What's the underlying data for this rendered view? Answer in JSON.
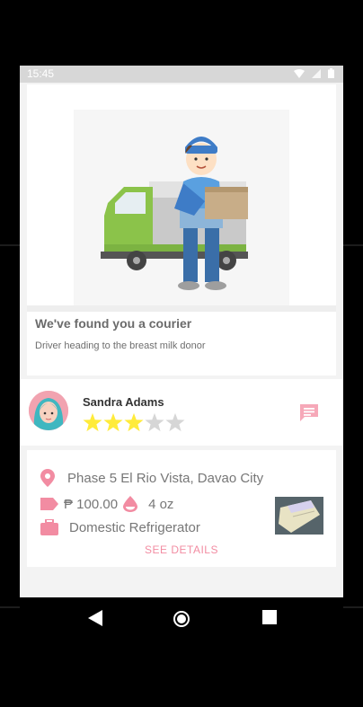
{
  "status_bar": {
    "time": "15:45"
  },
  "hero": {
    "title": "We've found you a courier",
    "subtitle": "Driver heading to the breast milk donor"
  },
  "courier": {
    "name": "Sandra Adams",
    "rating": 3,
    "rating_max": 5
  },
  "details": {
    "address": "Phase 5 El Rio Vista, Davao City",
    "price": "₱ 100.00",
    "quantity": "4 oz",
    "storage": "Domestic Refrigerator",
    "see_details_label": "SEE DETAILS"
  },
  "colors": {
    "accent": "#f28ca2",
    "star_on": "#ffeb3b",
    "star_off": "#d6d6d6"
  },
  "icons": {
    "location": "location-pin-icon",
    "price": "price-tag-icon",
    "quantity": "milk-drop-icon",
    "storage": "briefcase-icon",
    "chat": "chat-icon"
  }
}
